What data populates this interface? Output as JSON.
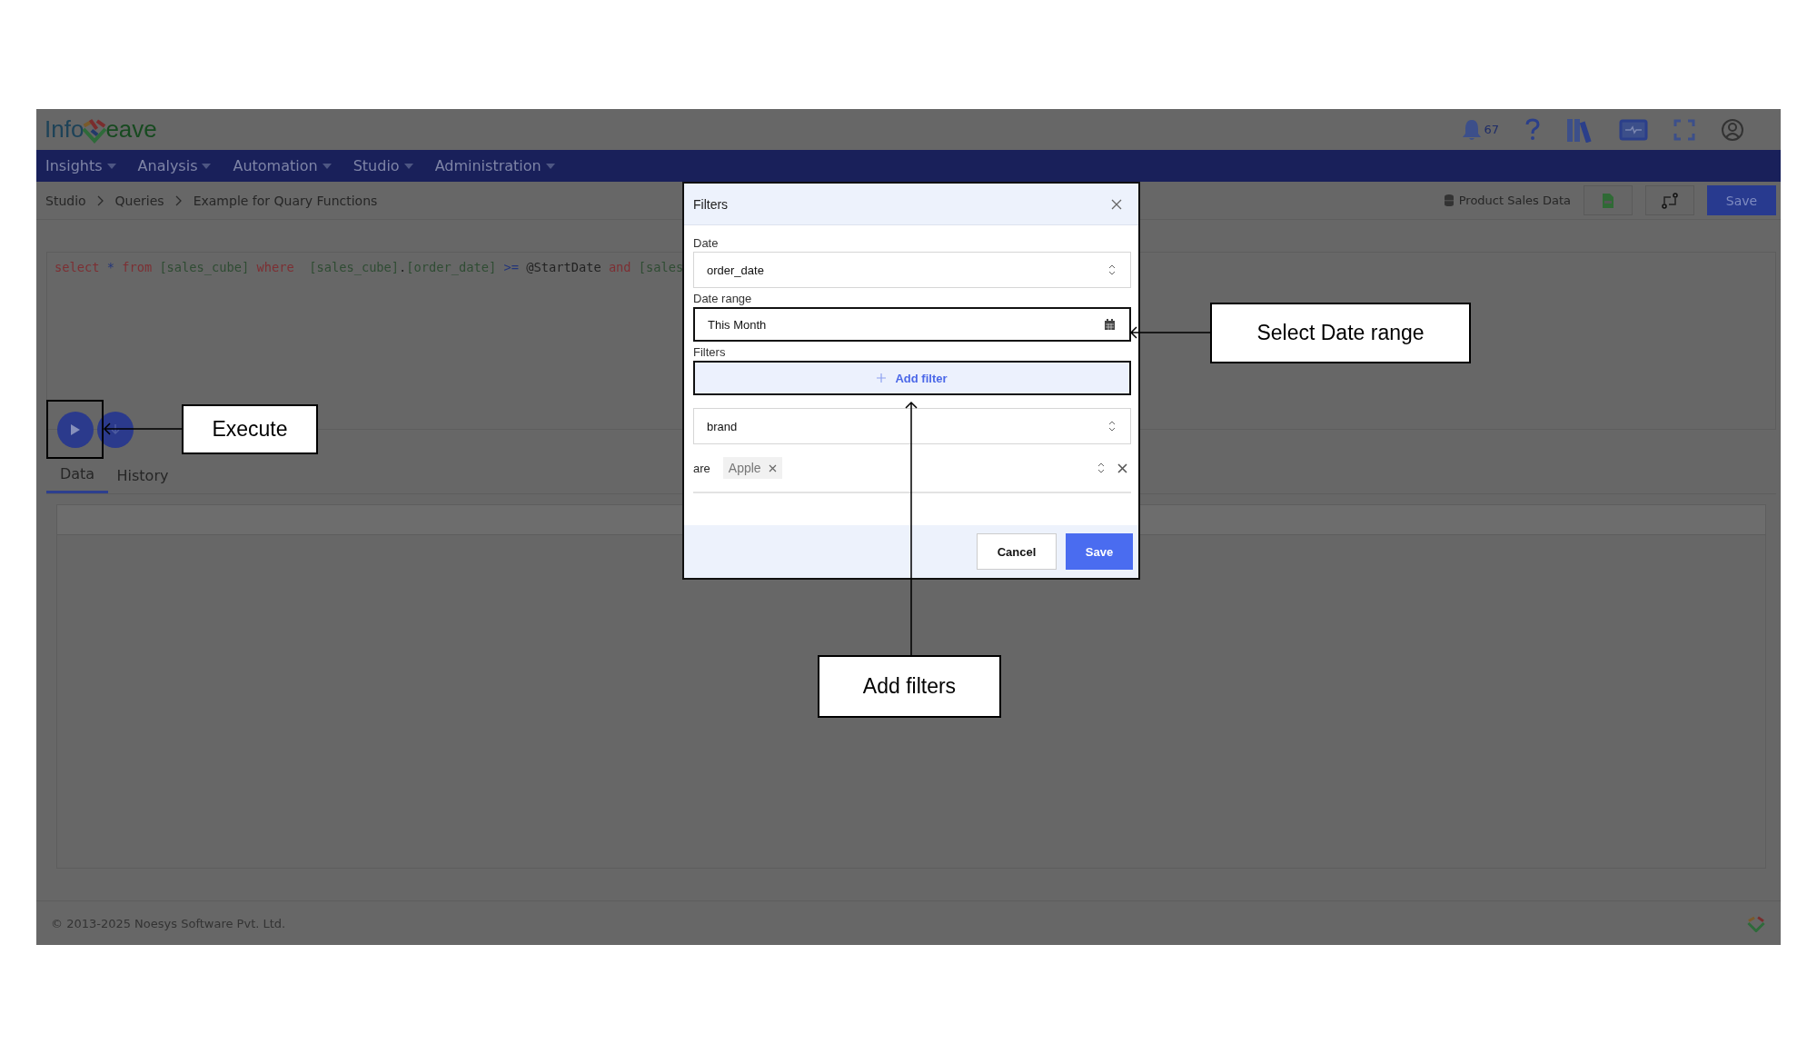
{
  "header": {
    "logo": {
      "before_mark": "Info",
      "after_mark": "eave"
    },
    "notification_count": "67"
  },
  "nav": [
    {
      "label": "Insights"
    },
    {
      "label": "Analysis"
    },
    {
      "label": "Automation"
    },
    {
      "label": "Studio"
    },
    {
      "label": "Administration"
    }
  ],
  "breadcrumb": [
    "Studio",
    "Queries",
    "Example for Quary Functions"
  ],
  "toolbar": {
    "datasource": "Product Sales Data",
    "save_label": "Save"
  },
  "editor": {
    "tokens": [
      {
        "text": "select ",
        "kind": "keyword"
      },
      {
        "text": "* ",
        "kind": "operator"
      },
      {
        "text": "from ",
        "kind": "keyword"
      },
      {
        "text": "[sales_cube] ",
        "kind": "identifier"
      },
      {
        "text": "where  ",
        "kind": "keyword"
      },
      {
        "text": "[sales_cube]",
        "kind": "identifier"
      },
      {
        "text": ".",
        "kind": "plain"
      },
      {
        "text": "[order_date] ",
        "kind": "identifier"
      },
      {
        "text": ">= ",
        "kind": "operator"
      },
      {
        "text": "@StartDate ",
        "kind": "plain"
      },
      {
        "text": "and ",
        "kind": "keyword"
      },
      {
        "text": "[sales",
        "kind": "identifier"
      }
    ]
  },
  "tabs": [
    {
      "label": "Data",
      "selected": true
    },
    {
      "label": "History",
      "selected": false
    }
  ],
  "footer": "© 2013-2025 Noesys Software Pvt. Ltd.",
  "modal": {
    "title": "Filters",
    "date_label": "Date",
    "date_value": "order_date",
    "range_label": "Date range",
    "range_value": "This Month",
    "range_highlighted": true,
    "filters_label": "Filters",
    "add_filter": "Add filter",
    "add_filter_highlighted": true,
    "filter": {
      "field": "brand",
      "operator": "are",
      "values": [
        "Apple"
      ]
    },
    "cancel": "Cancel",
    "save": "Save"
  },
  "annotations": [
    {
      "label": "Select Date range"
    },
    {
      "label": "Execute"
    },
    {
      "label": "Add filters"
    }
  ]
}
